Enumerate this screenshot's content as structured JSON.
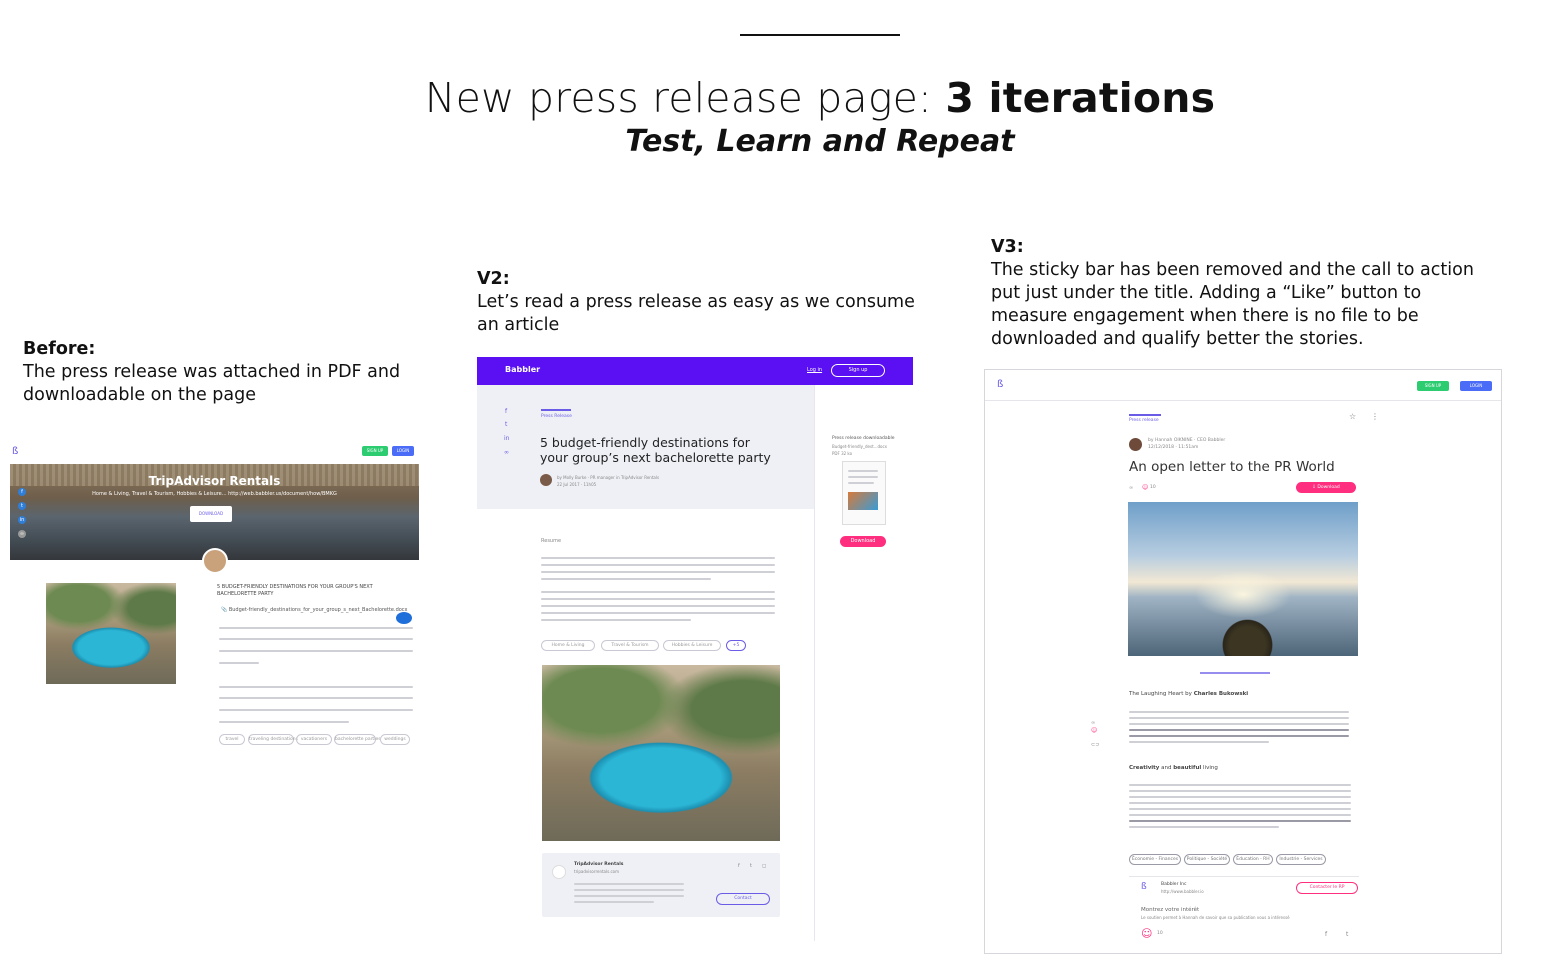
{
  "header": {
    "title_regular": "New press release page: ",
    "title_bold": "3 iterations",
    "subtitle": "Test, Learn and Repeat"
  },
  "captions": {
    "before": {
      "heading": "Before:",
      "text": "The press release was attached in PDF and downloadable on the page"
    },
    "v2": {
      "heading": "V2:",
      "text": "Let’s read a press release as easy as we consume an article"
    },
    "v3": {
      "heading": "V3:",
      "text": "The sticky bar has been removed and the call to action put just under the title. Adding a “Like” button to measure engagement when there is no file to be downloaded and qualify better the stories."
    }
  },
  "before_shot": {
    "sign_up": "SIGN UP",
    "login": "LOGIN",
    "hero_title": "TripAdvisor Rentals",
    "hero_meta": "Home & Living, Travel & Tourism, Hobbies & Leisure...   http://web.babbler.us/document/how/BMKG",
    "hero_button": "DOWNLOAD",
    "headline": "5 BUDGET-FRIENDLY DESTINATIONS FOR YOUR GROUP'S NEXT BACHELORETTE PARTY",
    "file": "Budget-friendly_destinations_for_your_group_s_next_Bachelorette.docx",
    "tags": [
      "travel",
      "traveling destinations",
      "vacationers",
      "bachelorette parties",
      "weddings"
    ]
  },
  "v2_shot": {
    "brand": "Babbler",
    "login": "Log in",
    "signup": "Sign up",
    "category": "Press Release",
    "headline_1": "5 budget-friendly destinations for",
    "headline_2": "your group’s next bachelorette party",
    "byline": "by Molly Burke · PR manager in TripAdvisor Rentals",
    "date": "22 Jul 2017 · 11h05",
    "download_label": "Press release downloadable",
    "download_file": "Budget-friendly_dest...docx",
    "download_size": "PDF 32 ko",
    "download_button": "Download",
    "section": "Resume",
    "tags": [
      "Home & Living",
      "Travel & Tourism",
      "Hobbies & Leisure",
      "+5"
    ],
    "company": "TripAdvisor Rentals",
    "company_url": "tripadvisorrentals.com",
    "contact": "Contact"
  },
  "v3_shot": {
    "sign_up": "SIGN UP",
    "login": "LOGIN",
    "category": "Press release",
    "author": "by Hannah OIKNINE · CEO Babbler",
    "date": "12/12/2018 · 11:51am",
    "headline": "An open letter to the PR World",
    "likes": "10",
    "download": "Download",
    "section_1_prefix": "The Laughing Heart by ",
    "section_1_author": "Charles Bukowski",
    "section_2_a": "Creativity",
    "section_2_b": " and ",
    "section_2_c": "beautiful",
    "section_2_d": " living",
    "tags": [
      "Économie - Finances",
      "Politique - Société",
      "Éducation - RH",
      "Industrie - Services"
    ],
    "company": "Babbler Inc",
    "company_url": "http://www.babbler.io",
    "contact": "Contacter le RP",
    "interest_title": "Montrez votre intérêt",
    "interest_text": "Le soutien permet à Hannah de savoir que sa publication vous a intéressé",
    "interest_count": "10"
  },
  "colors": {
    "v2_bar": "#5a10f2",
    "download_pink": "#ff2e7e",
    "signup_green": "#2ecc71",
    "login_blue": "#4a6cf7",
    "accent_purple": "#6b5ce7"
  }
}
